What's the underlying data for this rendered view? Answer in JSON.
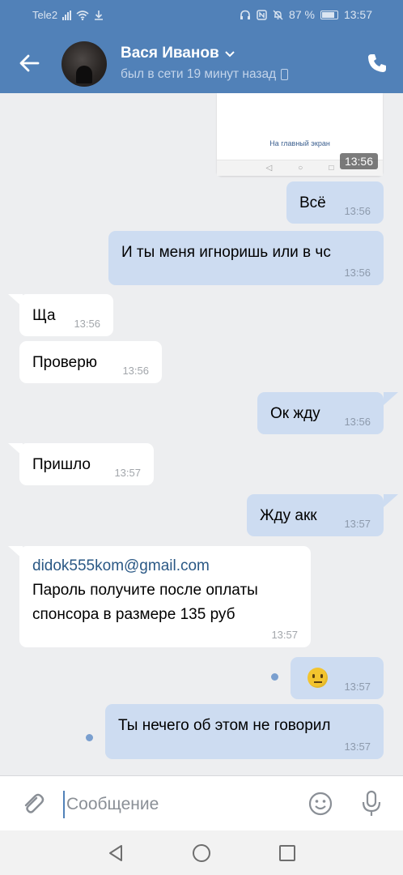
{
  "status_bar": {
    "carrier": "Tele2",
    "battery": "87 %",
    "time": "13:57"
  },
  "header": {
    "contact_name": "Вася Иванов",
    "last_seen": "был в сети 19 минут назад"
  },
  "screenshot_attachment": {
    "link_text": "На главный экран",
    "time": "13:56"
  },
  "messages": [
    {
      "dir": "out",
      "text": "Всё",
      "time": "13:56"
    },
    {
      "dir": "out",
      "text": "И ты меня игноришь или в чс",
      "time": "13:56"
    },
    {
      "dir": "in",
      "text": "Ща",
      "time": "13:56"
    },
    {
      "dir": "in",
      "text": "Проверю",
      "time": "13:56"
    },
    {
      "dir": "out",
      "text": "Ок жду",
      "time": "13:56"
    },
    {
      "dir": "in",
      "text": "Пришло",
      "time": "13:57"
    },
    {
      "dir": "out",
      "text": "Жду акк",
      "time": "13:57"
    },
    {
      "dir": "in",
      "email": "didok555kom@gmail.com",
      "line1": "Пароль получите после оплаты",
      "line2": "спонсора в размере 135 руб",
      "time": "13:57"
    },
    {
      "dir": "out",
      "emoji": "slightly-smiling-face",
      "time": "13:57"
    },
    {
      "dir": "out",
      "text": "Ты нечего об этом не говорил",
      "time": "13:57"
    }
  ],
  "composer": {
    "placeholder": "Сообщение",
    "value": ""
  },
  "colors": {
    "header": "#5181b8",
    "outgoing_bubble": "#cddcf1",
    "incoming_bubble": "#ffffff",
    "chat_background": "#edeef0"
  }
}
